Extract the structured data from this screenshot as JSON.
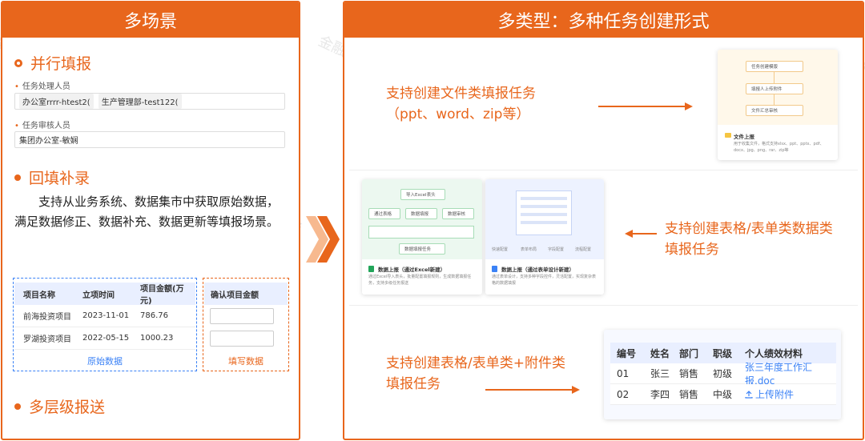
{
  "left_panel": {
    "header": "多场景",
    "section1": {
      "title": "并行填报",
      "label_handler": "任务处理人员",
      "handler_tags": [
        "办公室rrrr-htest2(",
        "生产管理部-test122("
      ],
      "label_reviewer": "任务审核人员",
      "reviewer_value": "集团办公室-敏娴"
    },
    "section2": {
      "title": "回填补录",
      "paragraph": "支持从业务系统、数据集市中获取原始数据，满足数据修正、数据补充、数据更新等填报场景。"
    },
    "table": {
      "headers": [
        "项目名称",
        "立项时间",
        "项目金额(万元)"
      ],
      "extra_header": "确认项目金额",
      "rows": [
        [
          "前海投资项目",
          "2023-11-01",
          "786.76"
        ],
        [
          "罗湖投资项目",
          "2022-05-15",
          "1000.23"
        ]
      ],
      "caption_original": "原始数据",
      "caption_fill": "填写数据"
    },
    "section3": {
      "title": "多层级报送"
    }
  },
  "right_panel": {
    "header": "多类型：多种任务创建形式",
    "feature1": {
      "line1": "支持创建文件类填报任务",
      "line2": "（ppt、word、zip等）"
    },
    "feature2": {
      "line1": "支持创建表格/表单类数据类",
      "line2": "填报任务"
    },
    "feature3": {
      "line1": "支持创建表格/表单类+附件类",
      "line2": "填报任务"
    },
    "file_card": {
      "steps": [
        "任务创建模版",
        "填报人上传附件",
        "文件汇总审核"
      ],
      "title": "文件上报",
      "desc": "用于收集文件，格式支持xlsx、ppt、pptx、pdf、docx、jpg、png、rar、zip等"
    },
    "excel_card": {
      "top_node": "导入Excel表头",
      "middle_nodes": [
        "通过表格",
        "数据填报",
        "数据审核"
      ],
      "bottom_node": "数据填报任务",
      "title": "数据上报（通过Excel新建）",
      "desc": "通过Excel导入表头，批量配置填报规则，生成数据填报任务，支持多级任务报送"
    },
    "form_card": {
      "foot_labels": [
        "快速配置",
        "表单布局",
        "字段配置",
        "流程配置"
      ],
      "title": "数据上报（通过表单设计新建）",
      "desc": "通过表单设计，支持多种字段控件，灵活配置，实现复杂表格的数据填报"
    },
    "employee_table": {
      "headers": [
        "编号",
        "姓名",
        "部门",
        "职级",
        "个人绩效材料"
      ],
      "rows": [
        [
          "01",
          "张三",
          "销售",
          "初级",
          "张三年度工作汇报.doc"
        ],
        [
          "02",
          "李四",
          "销售",
          "中级",
          "上传附件"
        ]
      ]
    }
  },
  "watermark": "金融壹账通",
  "colors": {
    "accent": "#e8661c",
    "blue": "#3b82f6",
    "header_bg": "#e9efff"
  }
}
